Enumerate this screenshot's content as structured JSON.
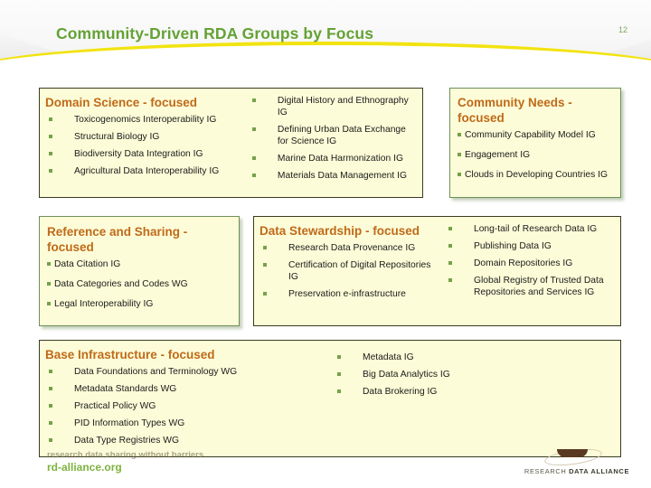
{
  "header": {
    "title": "Community-Driven RDA Groups by Focus",
    "page_number": "12",
    "title_color": "#64a235",
    "swoosh_color": "#f2e310"
  },
  "theme": {
    "box_fill": "#fcfcd8",
    "box_border": "#3b3b22",
    "box_border_shadowed": "#6f8f5a",
    "heading_color": "#c06a19",
    "bullet_color": "#76a14a",
    "body_text_color": "#1b1b1b"
  },
  "boxes": {
    "domain_science": {
      "title": "Domain Science - focused",
      "items_col_a": [
        "Toxicogenomics Interoperability IG",
        "Structural Biology IG",
        "Biodiversity Data Integration IG",
        "Agricultural Data Interoperability IG"
      ],
      "items_col_b": [
        "Digital History and Ethnography IG",
        "Defining Urban Data Exchange for Science IG",
        "Marine Data Harmonization IG",
        "Materials Data Management IG"
      ]
    },
    "community_needs": {
      "title": "Community Needs - focused",
      "items": [
        "Community Capability Model IG",
        "Engagement IG",
        "Clouds in Developing Countries IG"
      ]
    },
    "reference_sharing": {
      "title": "Reference and Sharing - focused",
      "items": [
        "Data Citation IG",
        "Data Categories and Codes WG",
        "Legal Interoperability IG"
      ]
    },
    "data_stewardship": {
      "title": "Data Stewardship - focused",
      "items_col_a": [
        "Research Data Provenance IG",
        "Certification of Digital Repositories IG",
        "Preservation e-infrastructure"
      ],
      "items_col_b": [
        "Long-tail of Research Data IG",
        "Publishing Data IG",
        "Domain Repositories IG",
        "Global Registry of Trusted Data Repositories and Services IG"
      ]
    },
    "base_infrastructure": {
      "title": "Base Infrastructure - focused",
      "items_col_a": [
        "Data Foundations and Terminology WG",
        "Metadata Standards WG",
        "Practical Policy WG",
        "PID Information Types WG",
        "Data Type Registries WG"
      ],
      "items_col_b": [
        "Metadata IG",
        "Big Data Analytics IG",
        "Data Brokering IG"
      ]
    }
  },
  "footer": {
    "tagline": "research data sharing without barriers",
    "url": "rd-alliance.org",
    "logo_wordmark_light": "RESEARCH ",
    "logo_wordmark_bold": "DATA ALLIANCE"
  }
}
